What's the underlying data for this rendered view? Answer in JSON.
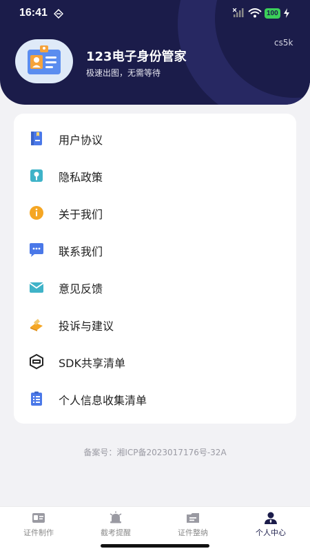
{
  "status_bar": {
    "time": "16:41",
    "battery": "100"
  },
  "profile": {
    "app_name": "123电子身份管家",
    "tagline": "极速出图，无需等待",
    "version": "cs5k"
  },
  "menu": [
    {
      "label": "用户协议",
      "icon": "book-icon",
      "color": "#4a78e8"
    },
    {
      "label": "隐私政策",
      "icon": "privacy-lock-icon",
      "color": "#3fb3c8"
    },
    {
      "label": "关于我们",
      "icon": "info-icon",
      "color": "#f5a623"
    },
    {
      "label": "联系我们",
      "icon": "chat-icon",
      "color": "#4a78e8"
    },
    {
      "label": "意见反馈",
      "icon": "mail-icon",
      "color": "#3fb3c8"
    },
    {
      "label": "投诉与建议",
      "icon": "complaint-icon",
      "color": "#f5a623"
    },
    {
      "label": "SDK共享清单",
      "icon": "sdk-icon",
      "color": "#222222"
    },
    {
      "label": "个人信息收集清单",
      "icon": "checklist-icon",
      "color": "#4a78e8"
    }
  ],
  "footer": {
    "icp": "备案号：湘ICP备2023017176号-32A"
  },
  "tabs": [
    {
      "label": "证件制作",
      "icon": "id-card-icon",
      "active": false
    },
    {
      "label": "截考提醒",
      "icon": "alarm-icon",
      "active": false
    },
    {
      "label": "证件整纳",
      "icon": "folder-icon",
      "active": false
    },
    {
      "label": "个人中心",
      "icon": "user-icon",
      "active": true
    }
  ],
  "colors": {
    "header_bg": "#1b1c4a",
    "accent": "#4a78e8",
    "page_bg": "#f2f2f5"
  }
}
